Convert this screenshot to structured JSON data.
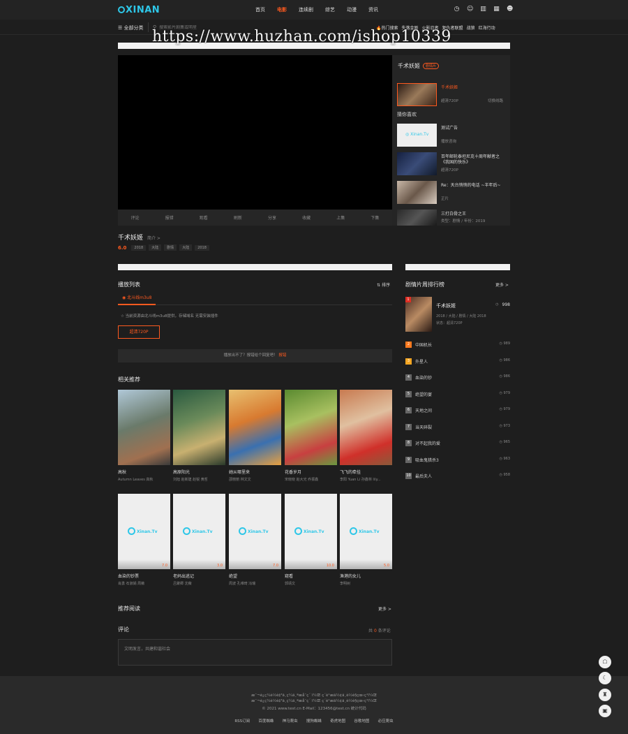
{
  "header": {
    "logo": "XINAN",
    "nav": [
      "首页",
      "电影",
      "连续剧",
      "综艺",
      "动漫",
      "资讯"
    ],
    "active_index": 1,
    "icons": [
      "clock-icon",
      "chat-icon",
      "chart-icon",
      "grid-icon",
      "user-icon"
    ]
  },
  "subbar": {
    "category_label": "☰ 全部分类",
    "search_placeholder": "搜索影片剧集或明星",
    "hot_label": "热门搜索",
    "hot_terms": [
      "失落金刚",
      "火影忍者",
      "复仇者联盟",
      "战狼",
      "红海行动"
    ]
  },
  "watermark": "https://www.huzhan.com/ishop10339",
  "player_controls": [
    "评论",
    "报错",
    "观看",
    "刷新",
    "分享",
    "收藏",
    "上集",
    "下集"
  ],
  "side_panel": {
    "title": "千术妖姬",
    "badge": "剧情片",
    "current": {
      "title": "千术妖姬",
      "quality": "超清720P",
      "switch": "切换线路"
    },
    "guess_title": "猜你喜欢",
    "items": [
      {
        "title": "测试广告",
        "sub": "播放咨询"
      },
      {
        "title": "百年邮轮泰坦尼克十周年献者之《我国的快乐》",
        "sub": "超清720P"
      },
      {
        "title": "Re：天台悄悄的电话 ~半年后~",
        "sub": "正片"
      },
      {
        "title": "三打白骨之王",
        "sub": "类型：剧情 / 年份：2019"
      }
    ]
  },
  "movie": {
    "title": "千术妖姬",
    "intro_label": "简介 >",
    "score": "6.0",
    "tags": [
      "2018",
      "大陆",
      "剧情",
      "大陆",
      "2018"
    ]
  },
  "playlist": {
    "title": "播放列表",
    "sort_label": "排序",
    "source_tab": "◉ 北斗线m3u8",
    "notice": "☆ 当前资源由北斗线m3u8提供，存储域名 无需安装插件",
    "episode": "超清720P",
    "report_text": "播放出不了？报错给个回复吧！",
    "report_link": "报错"
  },
  "related": {
    "title": "相关推荐",
    "row1": [
      {
        "name": "高秋",
        "actors": "Autumn Leaves 高秋"
      },
      {
        "name": "高原阳光",
        "actors": "刘旭 赵新建 赵锐 黄哲"
      },
      {
        "name": "她从哪里来",
        "actors": "邵丽丽 林文文"
      },
      {
        "name": "花香岁月",
        "actors": "宋晓晓 赵大光 乔振鑫"
      },
      {
        "name": "飞飞的牵挂",
        "actors": "李阳 Yuan Li 孙鑫林 lily..."
      }
    ],
    "row2": [
      {
        "name": "血染的钞票",
        "actors": "肖勇 石淑娟 周薇",
        "score": "7.0"
      },
      {
        "name": "老妈出逃记",
        "actors": "吕聚卿 沈薇",
        "score": "3.0"
      },
      {
        "name": "绝望",
        "actors": "周波 孔维琦 冯瑞",
        "score": "7.0"
      },
      {
        "name": "窥看",
        "actors": "郭靖文",
        "score": "10.0"
      },
      {
        "name": "渔港的女儿",
        "actors": "李明树",
        "score": "5.0"
      }
    ]
  },
  "recommend": {
    "title": "推荐阅读",
    "more": "更多 >"
  },
  "comments": {
    "title": "评论",
    "count_prefix": "共",
    "count": "0",
    "count_suffix": "条评论",
    "placeholder": "文明发言，共建和谐社会"
  },
  "ranking": {
    "title": "剧情片周排行榜",
    "more": "更多 >",
    "top": {
      "rank": "1",
      "name": "千术妖姬",
      "line1": "2018 / 大陆 / 剧情 / 大陆 2018",
      "line2": "状态：超清720P",
      "hot": "998"
    },
    "rows": [
      {
        "rank": "2",
        "name": "中国机长",
        "hot": "989",
        "color": "#ff7a1f"
      },
      {
        "rank": "3",
        "name": "外星人",
        "hot": "986",
        "color": "#f5a623"
      },
      {
        "rank": "4",
        "name": "血染的钞",
        "hot": "986",
        "color": "#666666"
      },
      {
        "rank": "5",
        "name": "绝望的宴",
        "hot": "979",
        "color": "#666666"
      },
      {
        "rank": "6",
        "name": "天地之间",
        "hot": "979",
        "color": "#666666"
      },
      {
        "rank": "7",
        "name": "当天碎裂",
        "hot": "973",
        "color": "#666666"
      },
      {
        "rank": "8",
        "name": "对不起我的爱",
        "hot": "965",
        "color": "#666666"
      },
      {
        "rank": "9",
        "name": "吸血鬼猎杀3",
        "hot": "963",
        "color": "#666666"
      },
      {
        "rank": "10",
        "name": "最后夫人",
        "hot": "958",
        "color": "#666666"
      }
    ]
  },
  "footer": {
    "line1": "æ¯¬è¿ç¼è½è‡³ä¸ç¼ä¸ªæå¯ç´ ï¼Œ ç´è¹æä½¢ä¸è½è§çœ‹ç¹ï¼Œ",
    "line2": "æ¯¬è¿ç¼è½è‡³ä¸ç¼ä¸ªæå¯ç´ ï¼Œ ç´è¹æä½¢ä¸è½è§çœ‹ç¹ï¼Œ",
    "copyright": "© 2021 www.test.cn  E-Mail：123456@test.cn  统计代码",
    "links": [
      "RSS订阅",
      "百度蜘蛛",
      "神马爬虫",
      "搜狗蜘蛛",
      "奇虎地图",
      "谷歌地图",
      "必应爬虫"
    ]
  },
  "float_buttons": [
    "qq-icon",
    "moon-icon",
    "shirt-icon",
    "top-icon"
  ]
}
